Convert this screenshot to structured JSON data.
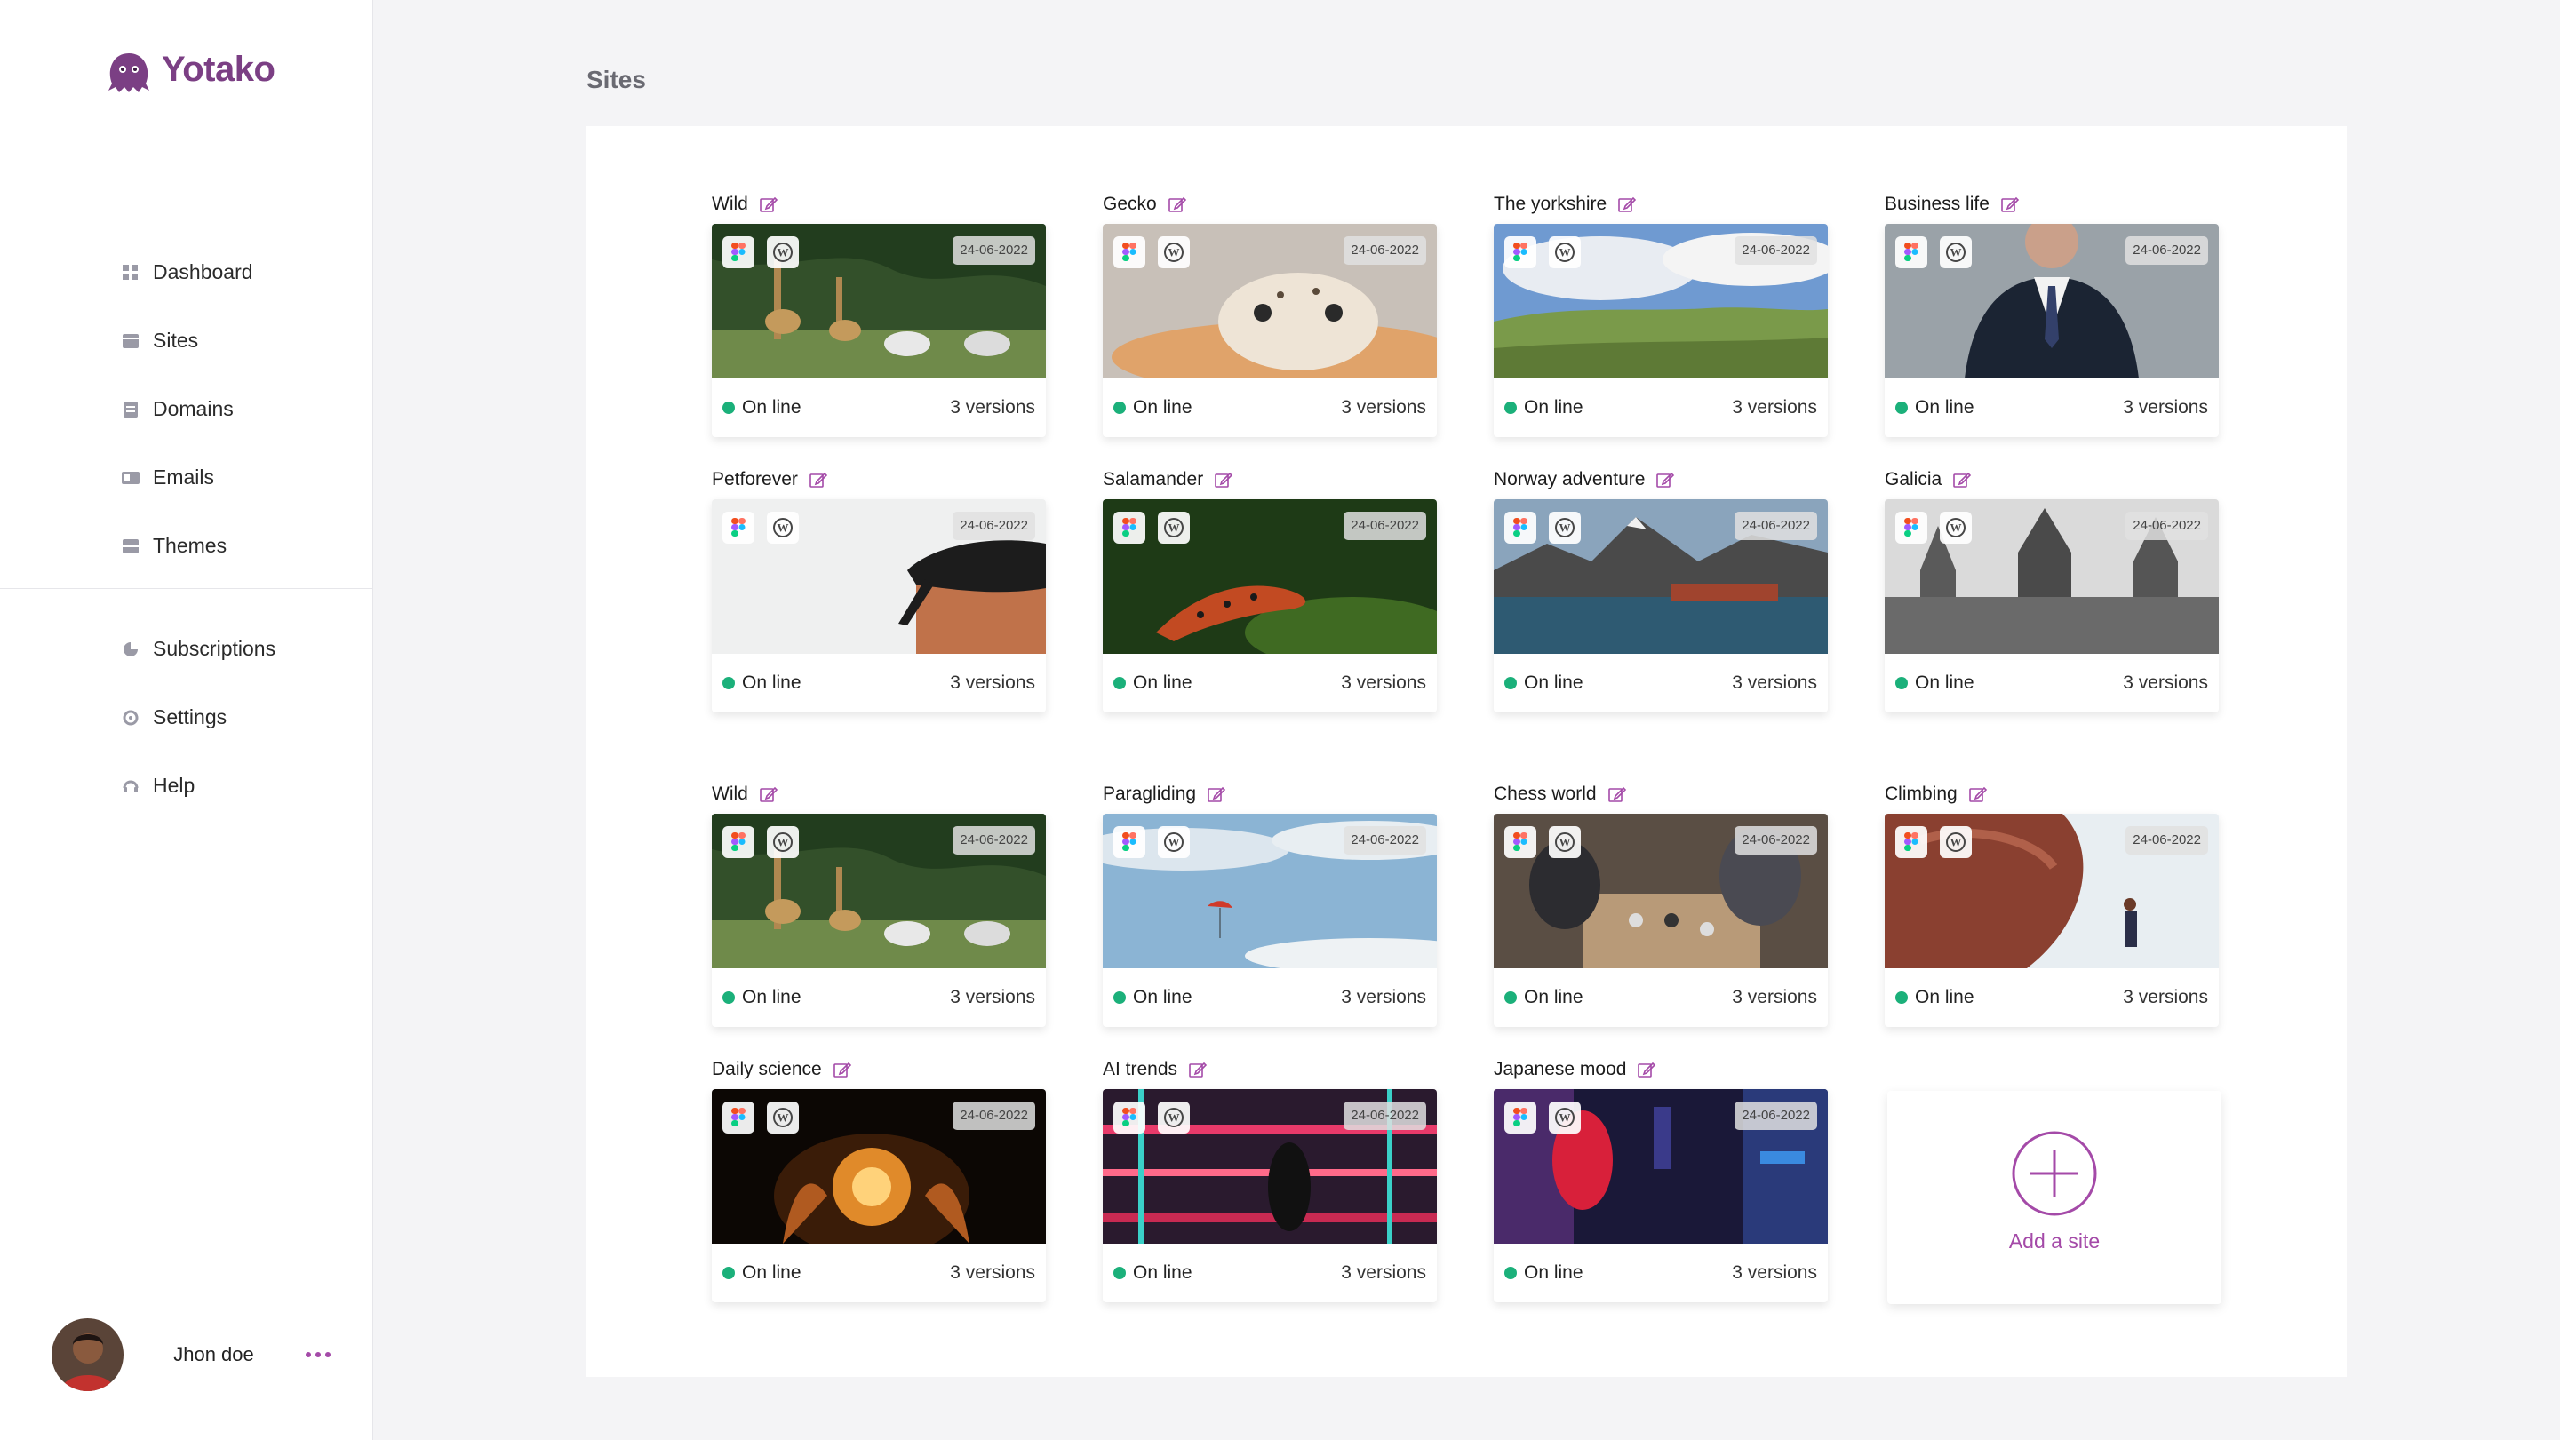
{
  "app": {
    "name": "Yotako",
    "brand_color": "#7b3f84",
    "accent_color": "#a44aa8",
    "online_color": "#1bb07a"
  },
  "sidebar": {
    "main_items": [
      {
        "label": "Dashboard",
        "icon": "grid-icon"
      },
      {
        "label": "Sites",
        "icon": "sites-icon"
      },
      {
        "label": "Domains",
        "icon": "domains-icon"
      },
      {
        "label": "Emails",
        "icon": "email-icon"
      },
      {
        "label": "Themes",
        "icon": "themes-icon"
      }
    ],
    "secondary_items": [
      {
        "label": "Subscriptions",
        "icon": "subscriptions-icon"
      },
      {
        "label": "Settings",
        "icon": "settings-icon"
      },
      {
        "label": "Help",
        "icon": "help-icon"
      }
    ],
    "user": {
      "name": "Jhon doe"
    }
  },
  "main": {
    "title": "Sites",
    "sites": [
      {
        "name": "Wild",
        "date": "24-06-2022",
        "status": "On line",
        "versions": "3 versions",
        "image": "giraffes-zebras"
      },
      {
        "name": "Gecko",
        "date": "24-06-2022",
        "status": "On line",
        "versions": "3 versions",
        "image": "gecko"
      },
      {
        "name": "The yorkshire",
        "date": "24-06-2022",
        "status": "On line",
        "versions": "3 versions",
        "image": "valley"
      },
      {
        "name": "Business life",
        "date": "24-06-2022",
        "status": "On line",
        "versions": "3 versions",
        "image": "suit"
      },
      {
        "name": "Petforever",
        "date": "24-06-2022",
        "status": "On line",
        "versions": "3 versions",
        "image": "cat"
      },
      {
        "name": "Salamander",
        "date": "24-06-2022",
        "status": "On line",
        "versions": "3 versions",
        "image": "salamander"
      },
      {
        "name": "Norway adventure",
        "date": "24-06-2022",
        "status": "On line",
        "versions": "3 versions",
        "image": "fjord"
      },
      {
        "name": "Galicia",
        "date": "24-06-2022",
        "status": "On line",
        "versions": "3 versions",
        "image": "cathedral"
      },
      {
        "name": "Wild",
        "date": "24-06-2022",
        "status": "On line",
        "versions": "3 versions",
        "image": "giraffes-zebras"
      },
      {
        "name": "Paragliding",
        "date": "24-06-2022",
        "status": "On line",
        "versions": "3 versions",
        "image": "paraglider"
      },
      {
        "name": "Chess world",
        "date": "24-06-2022",
        "status": "On line",
        "versions": "3 versions",
        "image": "chess"
      },
      {
        "name": "Climbing",
        "date": "24-06-2022",
        "status": "On line",
        "versions": "3 versions",
        "image": "climber"
      },
      {
        "name": "Daily science",
        "date": "24-06-2022",
        "status": "On line",
        "versions": "3 versions",
        "image": "lightbulb"
      },
      {
        "name": "AI trends",
        "date": "24-06-2022",
        "status": "On line",
        "versions": "3 versions",
        "image": "neon-city"
      },
      {
        "name": "Japanese mood",
        "date": "24-06-2022",
        "status": "On line",
        "versions": "3 versions",
        "image": "lanterns"
      }
    ],
    "add_site_label": "Add a site"
  }
}
